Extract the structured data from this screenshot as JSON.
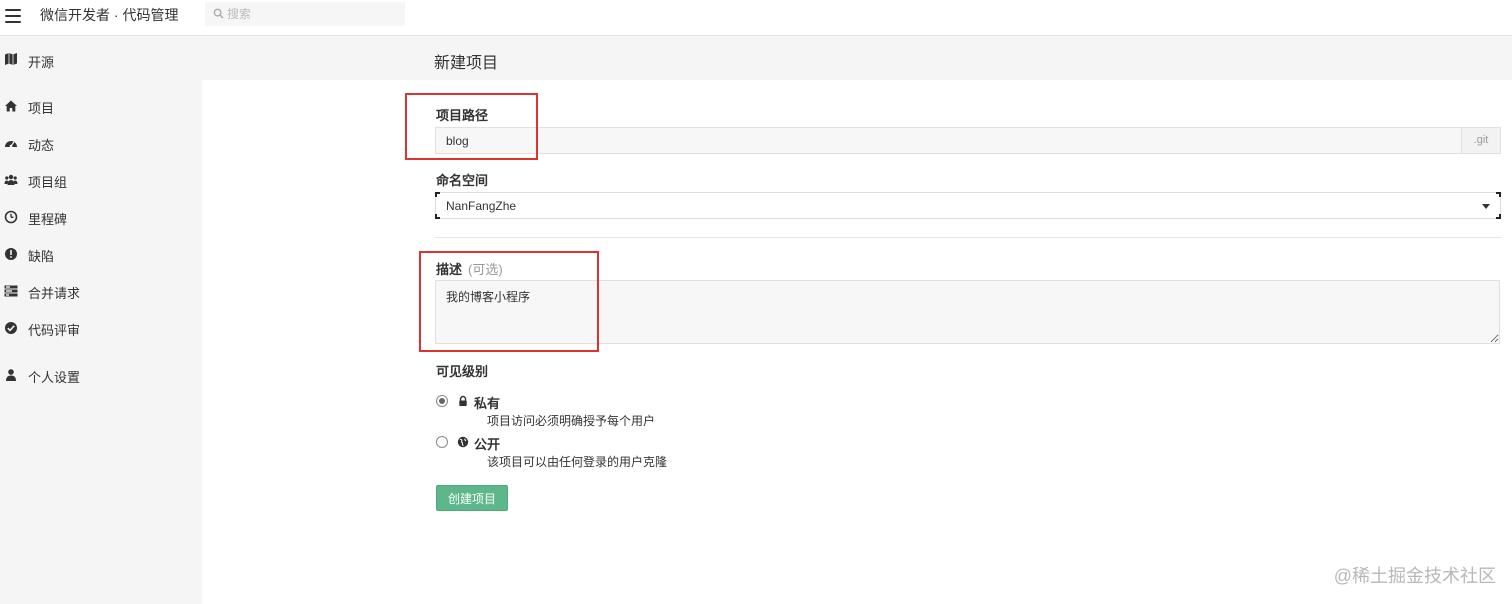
{
  "header": {
    "app_title": "微信开发者 · 代码管理",
    "search_placeholder": "搜索"
  },
  "sidebar": {
    "group_label": "开源",
    "items": [
      {
        "label": "项目",
        "icon": "home-icon"
      },
      {
        "label": "动态",
        "icon": "dashboard-icon"
      },
      {
        "label": "项目组",
        "icon": "users-icon"
      },
      {
        "label": "里程碑",
        "icon": "clock-icon"
      },
      {
        "label": "缺陷",
        "icon": "exclamation-icon"
      },
      {
        "label": "合并请求",
        "icon": "merge-icon"
      },
      {
        "label": "代码评审",
        "icon": "check-circle-icon"
      },
      {
        "label": "个人设置",
        "icon": "user-icon"
      }
    ]
  },
  "page": {
    "title": "新建项目",
    "path_label": "项目路径",
    "path_value": "blog",
    "path_suffix": ".git",
    "namespace_label": "命名空间",
    "namespace_value": "NanFangZhe",
    "desc_label": "描述",
    "desc_optional": "(可选)",
    "desc_value": "我的博客小程序",
    "visibility_label": "可见级别",
    "visibility_options": [
      {
        "title": "私有",
        "desc": "项目访问必须明确授予每个用户",
        "checked": true,
        "icon": "lock-icon"
      },
      {
        "title": "公开",
        "desc": "该项目可以由任何登录的用户克隆",
        "checked": false,
        "icon": "globe-icon"
      }
    ],
    "create_button": "创建项目"
  },
  "watermark": "@稀土掘金技术社区",
  "colors": {
    "primary_button": "#5cb88a",
    "annotation": "#e03131",
    "sidebar_bg": "#f5f5f5"
  }
}
